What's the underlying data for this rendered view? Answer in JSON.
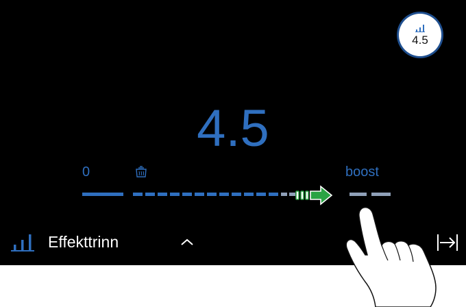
{
  "badge": {
    "value": "4.5",
    "icon": "power-level-icon"
  },
  "power": {
    "value": "4.5",
    "min_label": "0",
    "max_label": "boost",
    "level_fraction": 0.82,
    "keep_warm_icon": "pot-icon",
    "boost_arrow_icon": "boost-arrow-icon"
  },
  "bottom_bar": {
    "mode_label": "Effekttrinn",
    "mode_icon": "levels-icon",
    "expand_icon": "chevron-up-icon",
    "exit_icon": "exit-icon"
  },
  "colors": {
    "accent": "#2f6fbf",
    "inactive": "#8fa0b8",
    "boost": "#2aa344",
    "background": "#000000"
  }
}
